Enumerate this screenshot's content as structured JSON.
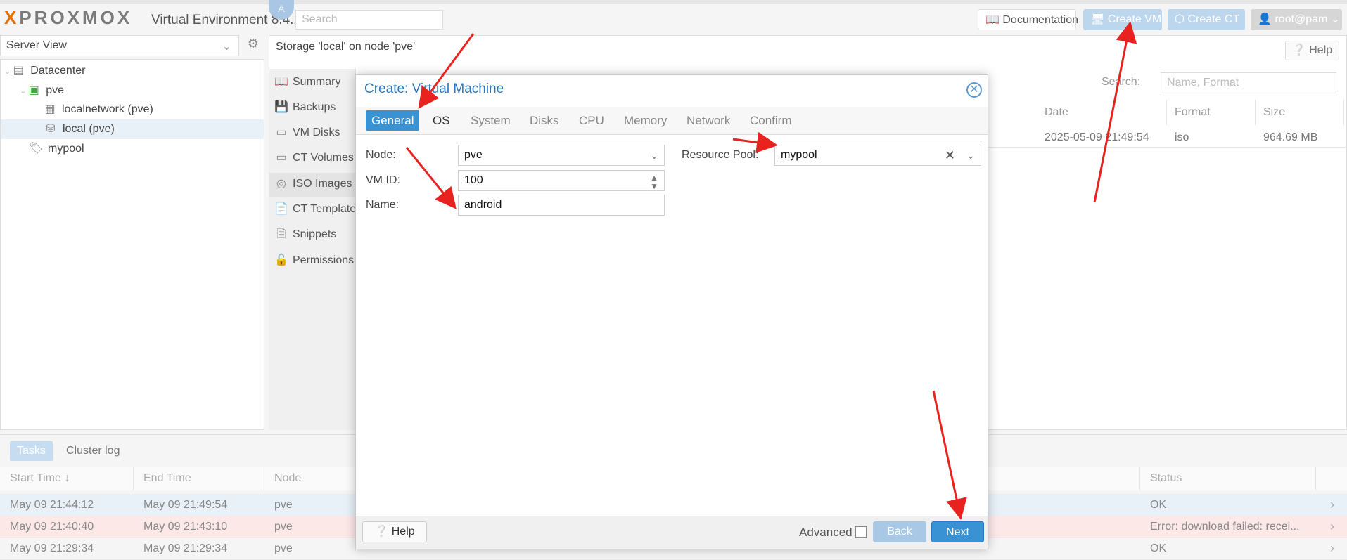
{
  "header": {
    "logo": "PROXMOX",
    "version": "Virtual Environment 8.4.1",
    "search_placeholder": "Search",
    "avatar_initial": "A",
    "documentation": "Documentation",
    "create_vm": "Create VM",
    "create_ct": "Create CT",
    "user": "root@pam"
  },
  "left": {
    "view_selector": "Server View",
    "tree": [
      {
        "label": "Datacenter",
        "icon": "datacenter-icon"
      },
      {
        "label": "pve",
        "icon": "node-online-icon"
      },
      {
        "label": "localnetwork (pve)",
        "icon": "network-grid-icon"
      },
      {
        "label": "local (pve)",
        "icon": "storage-icon"
      },
      {
        "label": "mypool",
        "icon": "tag-icon"
      }
    ]
  },
  "content": {
    "title": "Storage 'local' on node 'pve'",
    "help": "Help",
    "nav": [
      "Summary",
      "Backups",
      "VM Disks",
      "CT Volumes",
      "ISO Images",
      "CT Templates",
      "Snippets",
      "Permissions"
    ],
    "search_label": "Search:",
    "search_placeholder": "Name, Format",
    "columns": [
      "Date",
      "Format",
      "Size"
    ],
    "row": {
      "date": "2025-05-09 21:49:54",
      "format": "iso",
      "size": "964.69 MB"
    }
  },
  "bottom": {
    "tabs": [
      "Tasks",
      "Cluster log"
    ],
    "columns": [
      "Start Time ↓",
      "End Time",
      "Node",
      "Status"
    ],
    "rows": [
      {
        "start": "May 09 21:44:12",
        "end": "May 09 21:49:54",
        "node": "pve",
        "status": "OK"
      },
      {
        "start": "May 09 21:40:40",
        "end": "May 09 21:43:10",
        "node": "pve",
        "status": "Error: download failed: recei..."
      },
      {
        "start": "May 09 21:29:34",
        "end": "May 09 21:29:34",
        "node": "pve",
        "status": "OK"
      }
    ]
  },
  "modal": {
    "title": "Create: Virtual Machine",
    "tabs": [
      "General",
      "OS",
      "System",
      "Disks",
      "CPU",
      "Memory",
      "Network",
      "Confirm"
    ],
    "node_label": "Node:",
    "node_value": "pve",
    "vmid_label": "VM ID:",
    "vmid_value": "100",
    "name_label": "Name:",
    "name_value": "android",
    "pool_label": "Resource Pool:",
    "pool_value": "mypool",
    "help": "Help",
    "advanced": "Advanced",
    "back": "Back",
    "next": "Next"
  },
  "colors": {
    "accent": "#3892d4",
    "annotation": "#e8231f"
  }
}
